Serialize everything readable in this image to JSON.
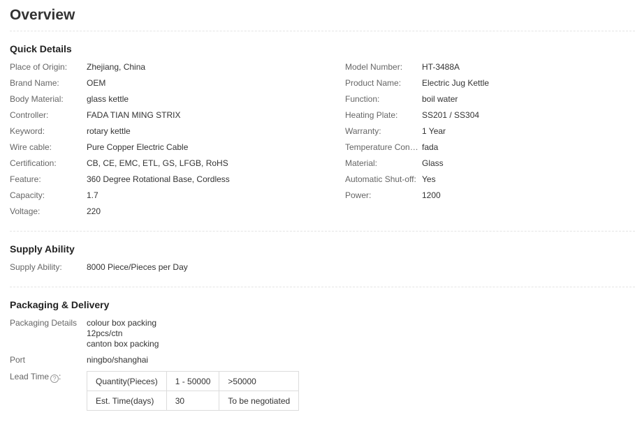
{
  "page_title": "Overview",
  "quick_details": {
    "title": "Quick Details",
    "left": [
      {
        "label": "Place of Origin:",
        "value": "Zhejiang, China"
      },
      {
        "label": "Brand Name:",
        "value": "OEM"
      },
      {
        "label": "Body Material:",
        "value": "glass kettle"
      },
      {
        "label": "Controller:",
        "value": "FADA TIAN MING STRIX"
      },
      {
        "label": "Keyword:",
        "value": "rotary kettle"
      },
      {
        "label": "Wire cable:",
        "value": "Pure Copper Electric Cable"
      },
      {
        "label": "Certification:",
        "value": "CB, CE, EMC, ETL, GS, LFGB, RoHS"
      },
      {
        "label": "Feature:",
        "value": "360 Degree Rotational Base, Cordless"
      },
      {
        "label": "Capacity:",
        "value": "1.7"
      },
      {
        "label": "Voltage:",
        "value": "220"
      }
    ],
    "right": [
      {
        "label": "Model Number:",
        "value": "HT-3488A"
      },
      {
        "label": "Product Name:",
        "value": "Electric Jug Kettle"
      },
      {
        "label": "Function:",
        "value": "boil water"
      },
      {
        "label": "Heating Plate:",
        "value": "SS201 / SS304"
      },
      {
        "label": "Warranty:",
        "value": "1 Year"
      },
      {
        "label": "Temperature Contr...",
        "value": "fada"
      },
      {
        "label": "Material:",
        "value": "Glass"
      },
      {
        "label": "Automatic Shut-off:",
        "value": "Yes"
      },
      {
        "label": "Power:",
        "value": "1200"
      }
    ]
  },
  "supply_ability": {
    "title": "Supply Ability",
    "label": "Supply Ability:",
    "value": "8000 Piece/Pieces per Day"
  },
  "packaging": {
    "title": "Packaging & Delivery",
    "details_label": "Packaging Details",
    "details_lines": [
      "colour box packing",
      "12pcs/ctn",
      "canton box packing"
    ],
    "port_label": "Port",
    "port_value": "ningbo/shanghai",
    "lead_time_label": "Lead Time",
    "help_icon": "question-circle-icon",
    "lead_table": [
      [
        "Quantity(Pieces)",
        "1 - 50000",
        ">50000"
      ],
      [
        "Est. Time(days)",
        "30",
        "To be negotiated"
      ]
    ]
  }
}
